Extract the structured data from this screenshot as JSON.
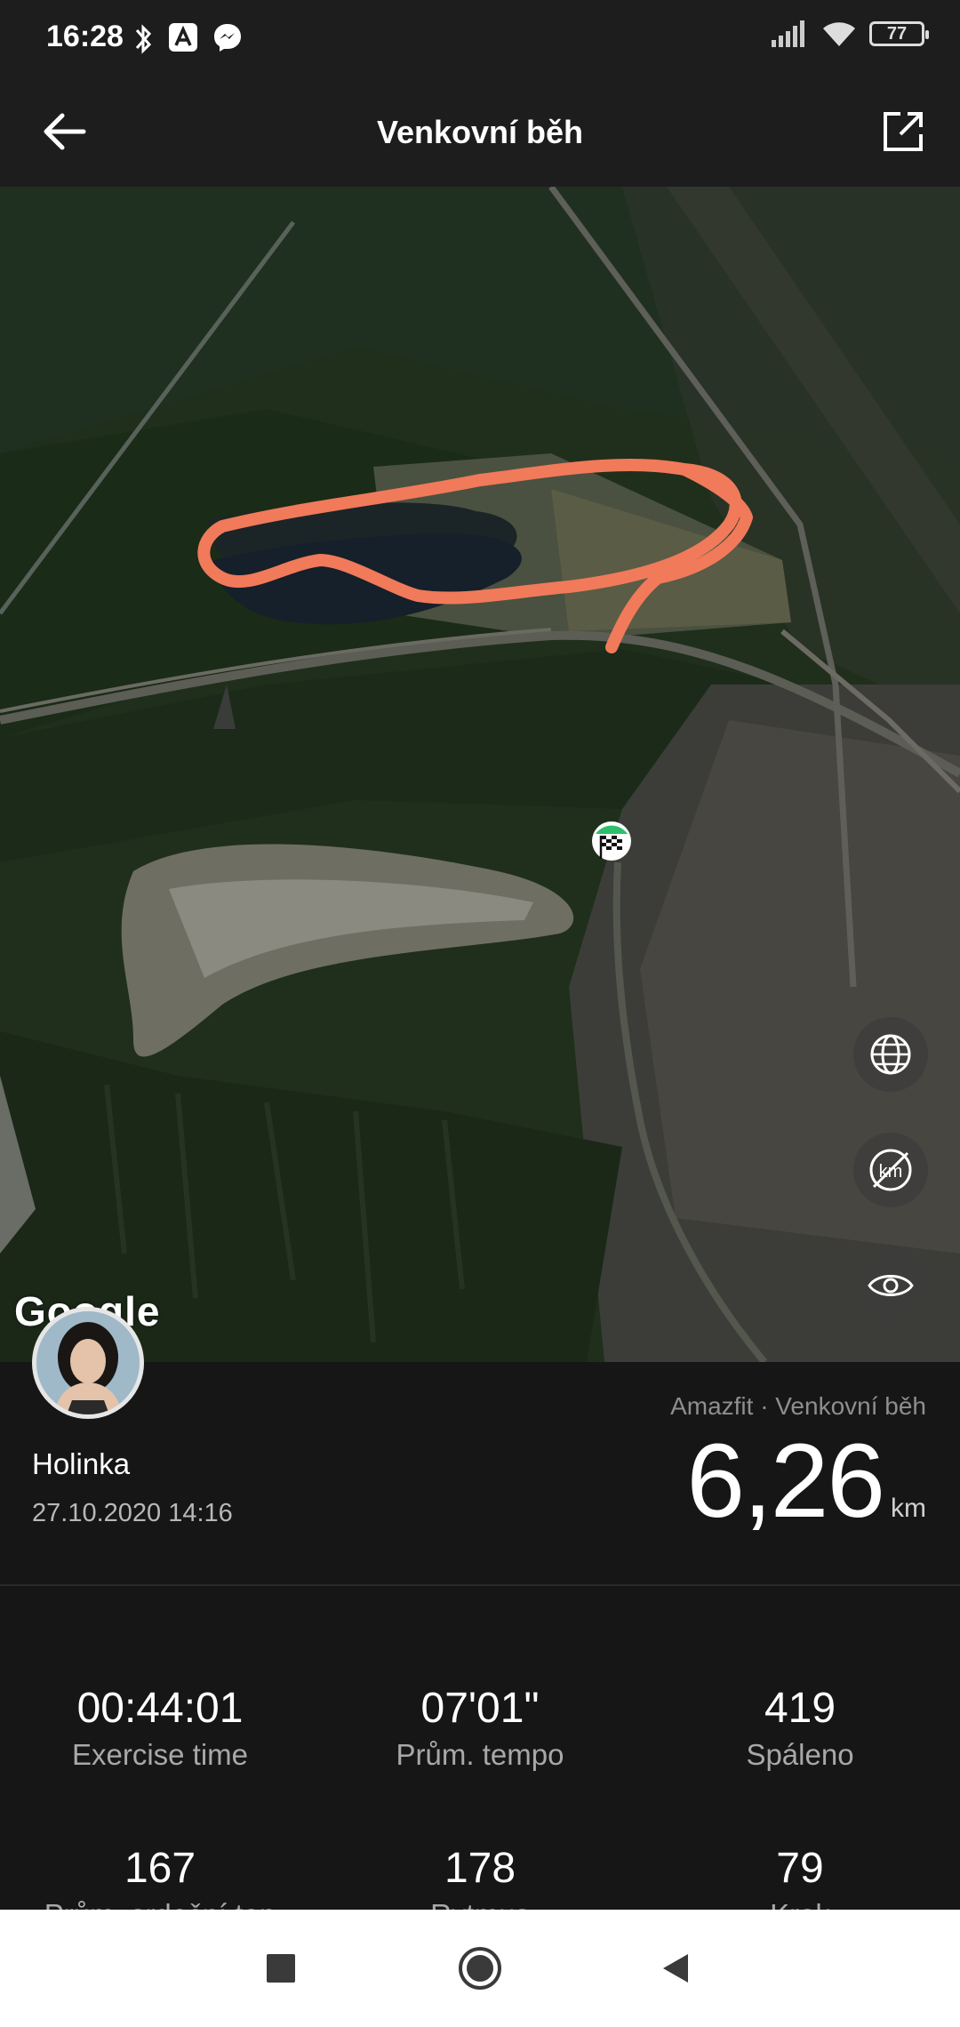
{
  "status_bar": {
    "time": "16:28",
    "battery": "77",
    "icons_left": [
      "bluetooth-icon",
      "app-notification-icon",
      "messenger-icon"
    ],
    "icons_right": [
      "signal-icon",
      "wifi-icon",
      "battery-icon"
    ]
  },
  "app_bar": {
    "title": "Venkovní běh",
    "back_icon": "arrow-left-icon",
    "share_icon": "share-external-icon"
  },
  "map": {
    "attribution": "Google",
    "route_color": "#f07a5a",
    "controls": [
      "globe-icon",
      "km-marker-off-icon",
      "eye-icon"
    ]
  },
  "profile": {
    "name": "Holinka",
    "date": "27.10.2020 14:16",
    "source": "Amazfit · Venkovní běh",
    "distance": "6,26",
    "distance_unit": "km"
  },
  "stats": [
    {
      "value": "00:44:01",
      "label": "Exercise time"
    },
    {
      "value": "07'01\"",
      "label": "Prům. tempo"
    },
    {
      "value": "419",
      "label": "Spáleno"
    },
    {
      "value": "167",
      "label": "Prům. srdeční tep"
    },
    {
      "value": "178",
      "label": "Rytmus"
    },
    {
      "value": "79",
      "label": "Krok"
    }
  ],
  "nav_bar": {
    "buttons": [
      "recents-square-icon",
      "home-circle-icon",
      "back-triangle-icon"
    ]
  }
}
